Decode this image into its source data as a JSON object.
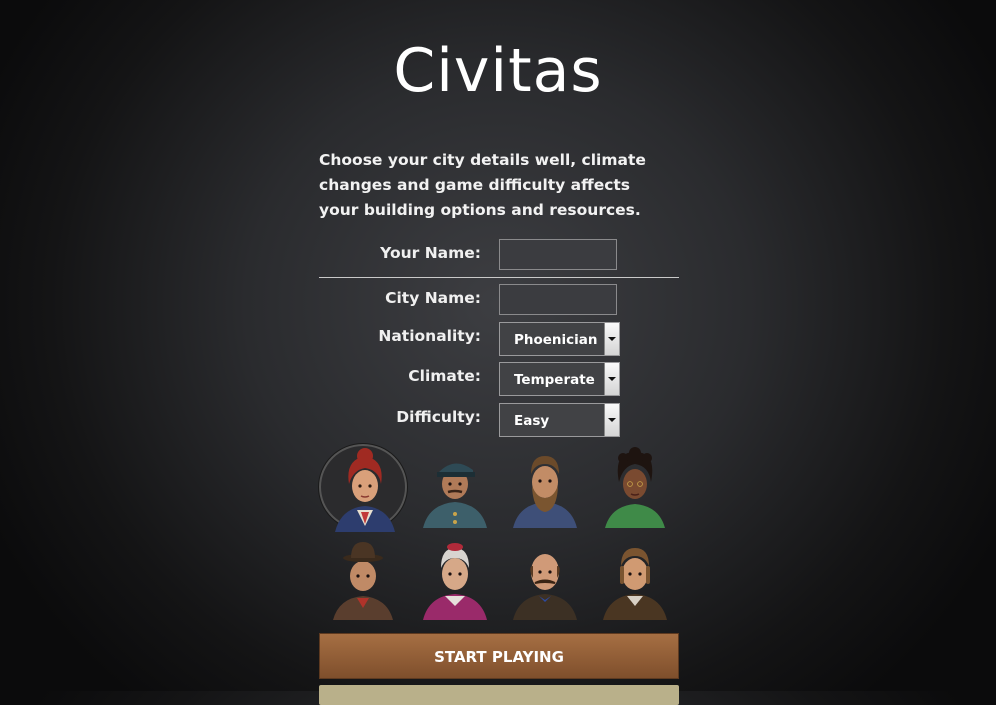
{
  "title": "Civitas",
  "intro": "Choose your city details well, climate changes and game difficulty affects your building options and resources.",
  "form": {
    "your_name_label": "Your Name:",
    "your_name_value": "",
    "city_name_label": "City Name:",
    "city_name_value": "",
    "nationality_label": "Nationality:",
    "nationality_value": "Phoenician",
    "climate_label": "Climate:",
    "climate_value": "Temperate",
    "difficulty_label": "Difficulty:",
    "difficulty_value": "Easy"
  },
  "avatars": [
    {
      "name": "avatar-woman-red-hair",
      "selected": true
    },
    {
      "name": "avatar-man-officer-cap",
      "selected": false
    },
    {
      "name": "avatar-man-beard",
      "selected": false
    },
    {
      "name": "avatar-woman-curly-hair",
      "selected": false
    },
    {
      "name": "avatar-man-bowler-hat",
      "selected": false
    },
    {
      "name": "avatar-old-woman-cardinal",
      "selected": false
    },
    {
      "name": "avatar-man-bald-mustache",
      "selected": false
    },
    {
      "name": "avatar-man-sideburns",
      "selected": false
    }
  ],
  "start_button": "START PLAYING",
  "colors": {
    "button_primary": "#8e5c37",
    "button_secondary": "#b9b08a"
  }
}
